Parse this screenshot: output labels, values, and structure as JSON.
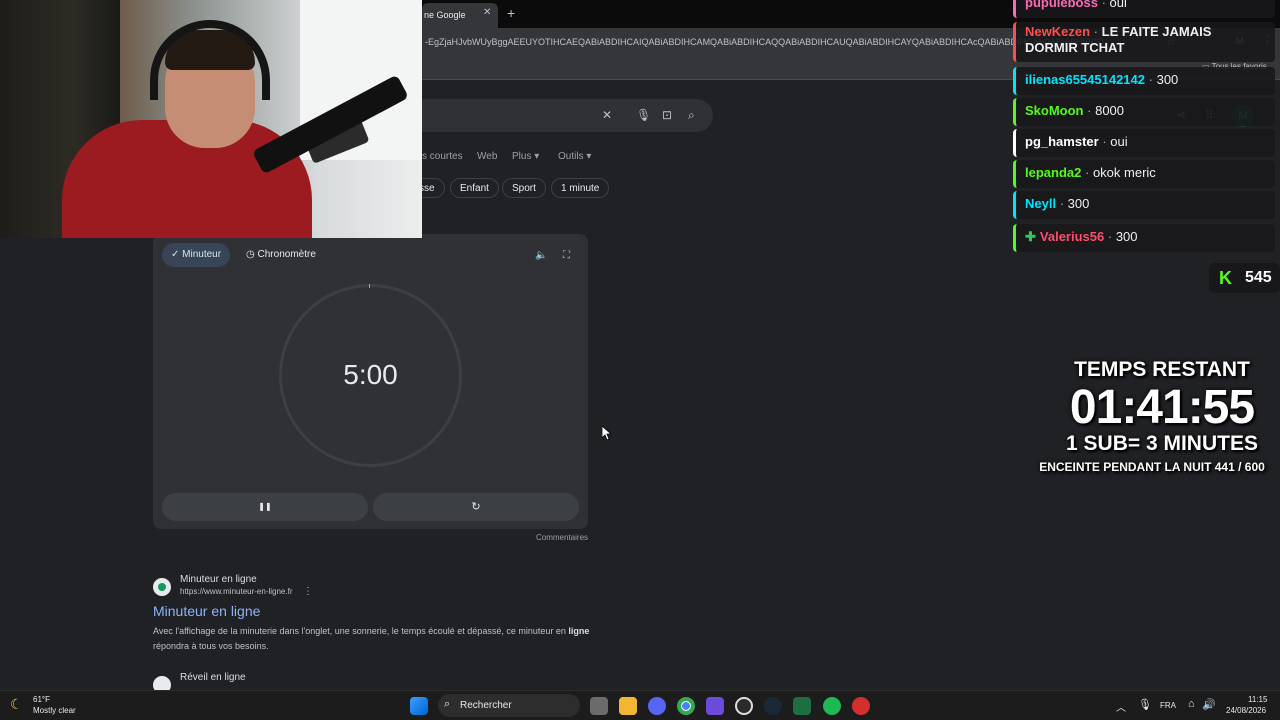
{
  "browser": {
    "tab_title": "ne Google",
    "url": "-EgZjaHJvbWUyBggAEEUYOTIHCAEQABiABDIHCAIQABiABDIHCAMQABiABDIHCAQQABiABDIHCAUQABiABDIHCAYQABiABDIHCAcQABiABDIHCAkQABiABNIBCD",
    "bookmarks_label": "Tous les favoris",
    "profile_initial": "M"
  },
  "search": {
    "filters": [
      "s courtes",
      "Web",
      "Plus ▾",
      "Outils ▾"
    ],
    "chips": [
      "sse",
      "Enfant",
      "Sport",
      "1 minute"
    ]
  },
  "timer": {
    "tab_minuteur": "Minuteur",
    "tab_chrono": "Chronomètre",
    "value": "5:00",
    "pause_glyph": "❚❚",
    "reset_glyph": "↻",
    "comments": "Commentaires"
  },
  "results": [
    {
      "site_name": "Minuteur en ligne",
      "url": "https://www.minuteur-en-ligne.fr",
      "title": "Minuteur en ligne",
      "snippet_part1": "Avec l'affichage de la minuterie dans l'onglet, une sonnerie, le temps écoulé et dépassé, ce minuteur en",
      "snippet_bold": "ligne",
      "snippet_part2": "répondra à tous vos besoins."
    },
    {
      "site_name": "Réveil en ligne"
    }
  ],
  "chat": [
    {
      "user": "pupuleboss",
      "text": "oui",
      "color": "#ff69b4"
    },
    {
      "user": "NewKezen",
      "text": "LE FAITE JAMAIS DORMIR TCHAT",
      "color": "#ff4d4d"
    },
    {
      "user": "ilienas65545142142",
      "text": "300",
      "color": "#00e5ff"
    },
    {
      "user": "SkoMoon",
      "text": "8000",
      "color": "#53fc18"
    },
    {
      "user": "pg_hamster",
      "text": "oui",
      "color": "#ffffff"
    },
    {
      "user": "lepanda2",
      "text": "okok meric",
      "color": "#53fc18"
    },
    {
      "user": "Neyll",
      "text": "300",
      "color": "#00e5ff"
    },
    {
      "user": "Valerius56",
      "text": "300",
      "color": "#ff4d6d"
    }
  ],
  "kick": {
    "logo": "K",
    "viewers": "545",
    "color": "#53fc18"
  },
  "subathon": {
    "label": "TEMPS RESTANT",
    "time": "01:41:55",
    "rule": "1 SUB= 3 MINUTES",
    "goal": "ENCEINTE PENDANT LA NUIT 441 / 600"
  },
  "taskbar": {
    "weather_temp": "61°F",
    "weather_desc": "Mostly clear",
    "search_label": "Rechercher",
    "lang": "FRA",
    "time": "11:15",
    "date": "24/08/2026"
  }
}
